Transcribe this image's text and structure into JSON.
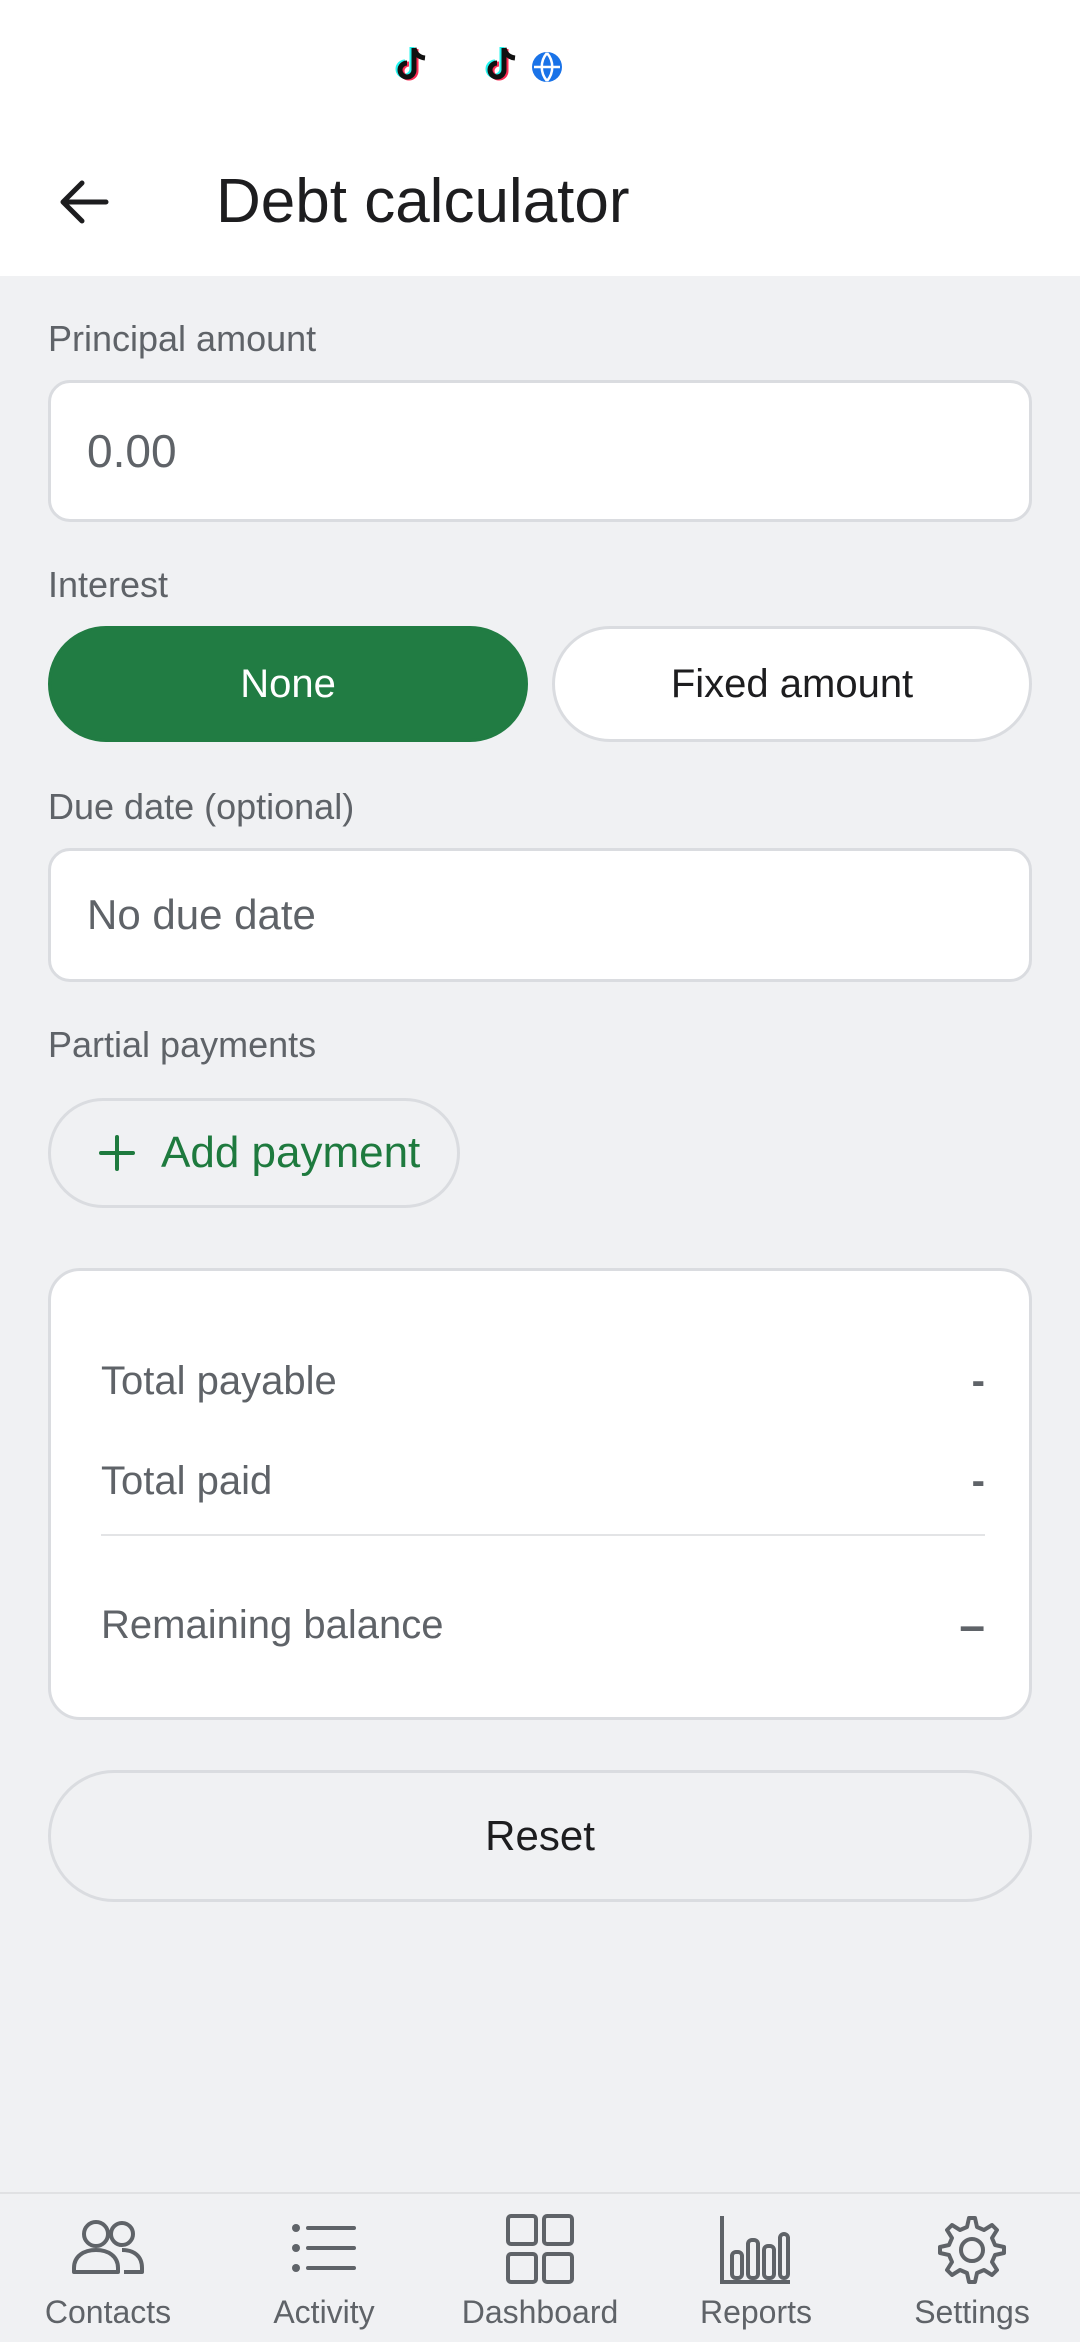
{
  "status_bar": {
    "icons": [
      "tiktok-icon",
      "tiktok-icon",
      "globe-icon"
    ]
  },
  "app_bar": {
    "back_icon": "arrow-back-icon",
    "title": "Debt calculator"
  },
  "form": {
    "principal": {
      "label": "Principal amount",
      "placeholder": "0.00",
      "value": ""
    },
    "interest": {
      "label": "Interest",
      "options": [
        "None",
        "Fixed amount"
      ],
      "selected": "None"
    },
    "due_date": {
      "label": "Due date (optional)",
      "value": "No due date"
    },
    "partial_payments": {
      "label": "Partial payments",
      "add_label": "Add payment",
      "add_icon": "plus-icon"
    }
  },
  "summary": {
    "total_payable_label": "Total payable",
    "total_payable_value": "-",
    "total_paid_label": "Total paid",
    "total_paid_value": "-",
    "remaining_label": "Remaining balance",
    "remaining_value": "–"
  },
  "reset_label": "Reset",
  "bottom_nav": {
    "items": [
      {
        "label": "Contacts",
        "icon": "people-icon"
      },
      {
        "label": "Activity",
        "icon": "list-icon"
      },
      {
        "label": "Dashboard",
        "icon": "grid-icon"
      },
      {
        "label": "Reports",
        "icon": "bar-chart-icon"
      },
      {
        "label": "Settings",
        "icon": "gear-icon"
      }
    ]
  },
  "colors": {
    "accent": "#217c43",
    "accent_text": "#1e7a3e",
    "background": "#f0f1f3",
    "surface": "#ffffff",
    "border": "#dadce0",
    "muted_text": "#5f6368"
  }
}
